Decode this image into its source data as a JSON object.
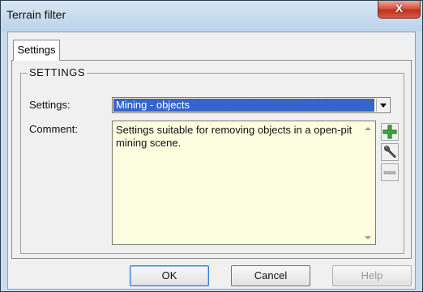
{
  "window": {
    "title": "Terrain filter",
    "close_label": "X"
  },
  "tabs": [
    {
      "label": "Settings"
    }
  ],
  "group": {
    "label": "SETTINGS"
  },
  "settings": {
    "label": "Settings:",
    "selected": "Mining - objects"
  },
  "comment": {
    "label": "Comment:",
    "text": "Settings suitable for removing objects in a open-pit mining scene."
  },
  "buttons": {
    "ok": "OK",
    "cancel": "Cancel",
    "help": "Help"
  },
  "icons": {
    "add": "plus-icon",
    "edit": "wrench-icon",
    "remove": "minus-icon",
    "close": "close-icon",
    "dropdown": "chevron-down-icon"
  },
  "colors": {
    "selection": "#3366cc",
    "comment_bg": "#fcfcdf",
    "add_green": "#3da83a"
  }
}
